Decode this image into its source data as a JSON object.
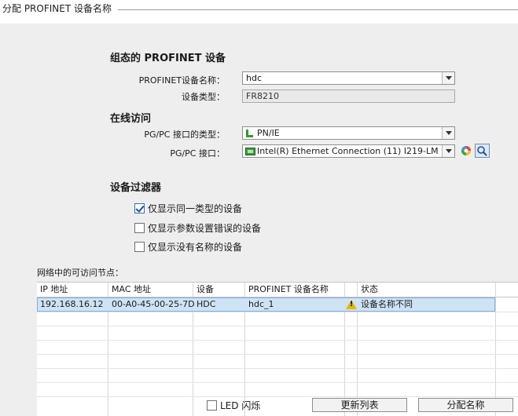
{
  "window": {
    "title": "分配 PROFINET 设备名称"
  },
  "configured": {
    "heading": "组态的 PROFINET 设备",
    "device_name_label": "PROFINET设备名称：",
    "device_name_value": "hdc",
    "device_type_label": "设备类型：",
    "device_type_value": "FR8210"
  },
  "online": {
    "heading": "在线访问",
    "interface_type_label": "PG/PC 接口的类型：",
    "interface_type_value": "PN/IE",
    "interface_label": "PG/PC 接口：",
    "interface_value": "Intel(R) Ethernet Connection (11) I219-LM"
  },
  "filter": {
    "heading": "设备过滤器",
    "options": [
      {
        "label": "仅显示同一类型的设备",
        "checked": true
      },
      {
        "label": "仅显示参数设置错误的设备",
        "checked": false
      },
      {
        "label": "仅显示没有名称的设备",
        "checked": false
      }
    ]
  },
  "nodes": {
    "caption": "网络中的可访问节点：",
    "columns": [
      "IP 地址",
      "MAC 地址",
      "设备",
      "PROFINET 设备名称",
      "状态"
    ],
    "rows": [
      {
        "ip": "192.168.16.12",
        "mac": "00-A0-45-00-25-7D",
        "device": "HDC",
        "name": "hdc_1",
        "status": "设备名称不同",
        "status_icon": "warning-icon"
      }
    ]
  },
  "footer": {
    "led_label": "LED 闪烁",
    "refresh_label": "更新列表",
    "assign_label": "分配名称"
  },
  "colors": {
    "panel": "#eeeeee",
    "selection": "#cfe3f6",
    "warning": "#e5b800"
  }
}
